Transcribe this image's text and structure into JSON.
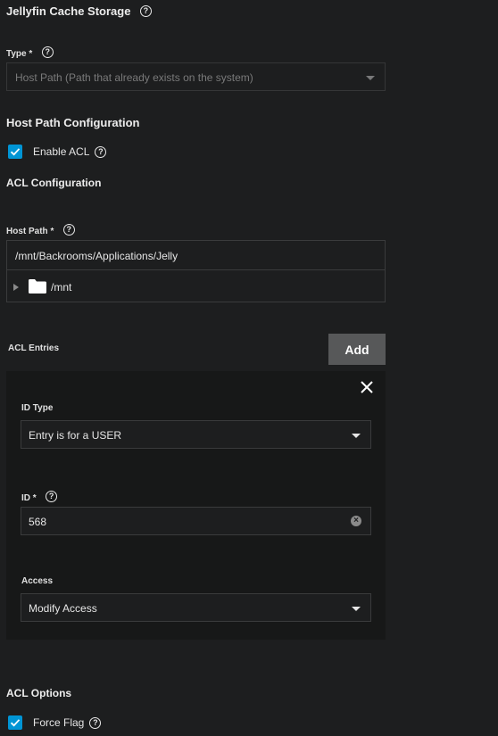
{
  "header": {
    "title": "Jellyfin Cache Storage"
  },
  "type_field": {
    "label": "Type *",
    "value": "Host Path (Path that already exists on the system)"
  },
  "host_path_config": {
    "heading": "Host Path Configuration",
    "enable_acl_label": "Enable ACL",
    "acl_config_heading": "ACL Configuration"
  },
  "host_path": {
    "label": "Host Path *",
    "value": "/mnt/Backrooms/Applications/Jelly",
    "tree_root": "/mnt"
  },
  "acl_entries": {
    "label": "ACL Entries",
    "add_label": "Add",
    "close_icon": "close-icon",
    "id_type_label": "ID Type",
    "id_type_value": "Entry is for a USER",
    "id_label": "ID *",
    "id_value": "568",
    "access_label": "Access",
    "access_value": "Modify Access"
  },
  "acl_options": {
    "heading": "ACL Options",
    "force_flag_label": "Force Flag"
  },
  "colors": {
    "accent": "#0095d5",
    "background": "#1d1e1f",
    "panel": "#171818",
    "button": "#575859"
  }
}
